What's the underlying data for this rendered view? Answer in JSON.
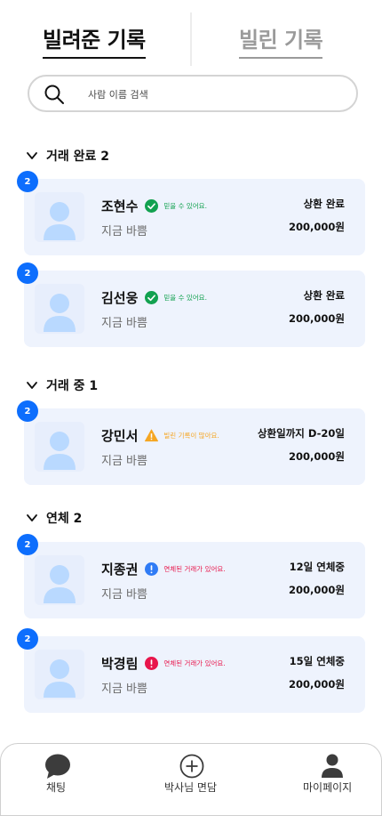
{
  "tabs": {
    "lent": "빌려준 기록",
    "borrowed": "빌린 기록",
    "active": "lent"
  },
  "search": {
    "placeholder": "사람 이름 검색",
    "value": ""
  },
  "sections": [
    {
      "title": "거래 완료 2"
    },
    {
      "title": "거래 중 1"
    },
    {
      "title": "연체 2"
    }
  ],
  "cards": [
    {
      "badge": "2",
      "name": "조현수",
      "status_icon": "check-circle-icon",
      "status_color": "#12a150",
      "status_text": "믿을 수 있어요.",
      "sub": "지금 바쁨",
      "right_status": "상환 완료",
      "amount": "200,000원"
    },
    {
      "badge": "2",
      "name": "김선웅",
      "status_icon": "check-circle-icon",
      "status_color": "#12a150",
      "status_text": "믿을 수 있어요.",
      "sub": "지금 바쁨",
      "right_status": "상환 완료",
      "amount": "200,000원"
    },
    {
      "badge": "2",
      "name": "강민서",
      "status_icon": "warning-triangle-icon",
      "status_color": "#f5a623",
      "status_text": "빌린 기록이 많아요.",
      "sub": "지금 바쁨",
      "right_status": "상환일까지 D-20일",
      "amount": "200,000원"
    },
    {
      "badge": "2",
      "name": "지종권",
      "status_icon": "info-circle-icon",
      "status_color": "#2f7bf5",
      "status_text": "연체된 거래가 있어요.",
      "sub": "지금 바쁨",
      "right_status": "12일 연체중",
      "amount": "200,000원"
    },
    {
      "badge": "2",
      "name": "박경림",
      "status_icon": "alert-circle-icon",
      "status_color": "#e8154b",
      "status_text": "연체된 거래가 있어요.",
      "sub": "지금 바쁨",
      "right_status": "15일 연체중",
      "amount": "200,000원"
    }
  ],
  "bottom_nav": [
    {
      "label": "채팅",
      "icon": "chat-bubble-icon"
    },
    {
      "label": "박사님 면담",
      "icon": "plus-circle-icon"
    },
    {
      "label": "마이페이지",
      "icon": "person-icon"
    }
  ],
  "colors": {
    "accent": "#0d6efd",
    "card_bg": "#eef3fd",
    "avatar": "#b9d9ff",
    "warn_text": "#f5a623",
    "danger_text": "#e8154b",
    "ok_text": "#12a150"
  }
}
